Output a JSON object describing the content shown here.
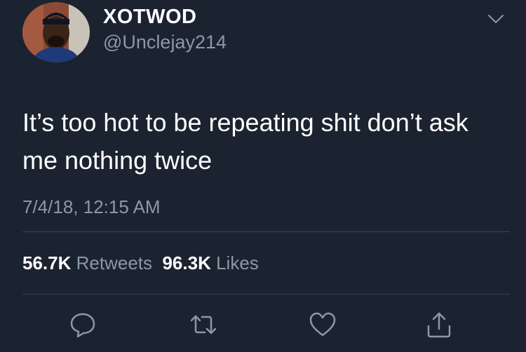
{
  "author": {
    "display_name": "XOTWOD",
    "handle": "@Unclejay214",
    "avatar_icon": "profile-photo"
  },
  "tweet": {
    "text": "It’s too hot to be repeating shit don’t ask me nothing twice",
    "timestamp": "7/4/18, 12:15 AM"
  },
  "stats": {
    "retweets_count": "56.7K",
    "retweets_label": "Retweets",
    "likes_count": "96.3K",
    "likes_label": "Likes"
  },
  "actions": [
    {
      "name": "reply",
      "icon": "speech-bubble-icon"
    },
    {
      "name": "retweet",
      "icon": "retweet-arrows-icon"
    },
    {
      "name": "like",
      "icon": "heart-icon"
    },
    {
      "name": "share",
      "icon": "share-upload-icon"
    }
  ],
  "colors": {
    "background": "#1b2330",
    "primary_text": "#ffffff",
    "secondary_text": "#8b98a8",
    "divider": "#38444d"
  }
}
